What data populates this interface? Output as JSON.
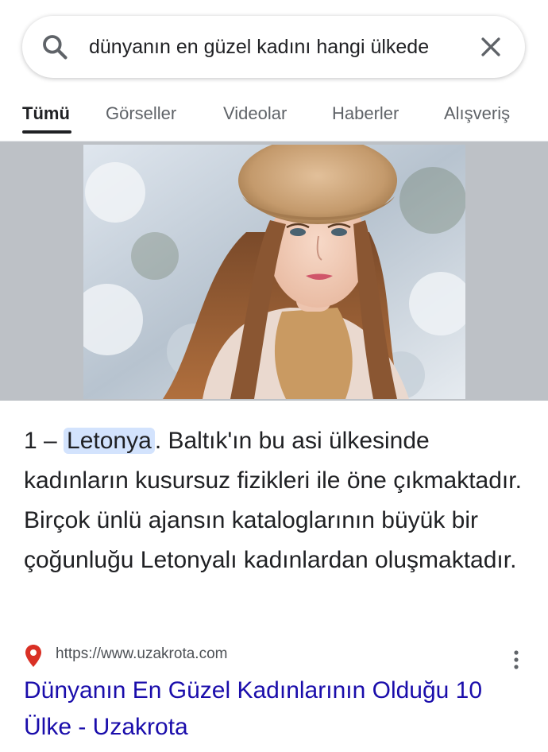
{
  "search": {
    "query": "dünyanın en güzel kadını hangi ülkede",
    "search_icon": "search-icon",
    "clear_icon": "close-icon"
  },
  "tabs": [
    {
      "label": "Tümü",
      "active": true
    },
    {
      "label": "Görseller",
      "active": false
    },
    {
      "label": "Videolar",
      "active": false
    },
    {
      "label": "Haberler",
      "active": false
    },
    {
      "label": "Alışveriş",
      "active": false
    }
  ],
  "featured_snippet": {
    "image_subject": "portrait of a woman wearing a fur hat in a snowy setting",
    "prefix": "1 – ",
    "highlight": "Letonya",
    "text": ". Baltık'ın bu asi ülkesinde kadınların kusursuz fizikleri ile öne çıkmaktadır. Birçok ünlü ajansın kataloglarının büyük bir çoğunluğu Letonyalı kadınlardan oluşmaktadır."
  },
  "source": {
    "url": "https://www.uzakrota.com",
    "title": "Dünyanın En Güzel Kadınlarının Olduğu 10 Ülke - Uzakrota",
    "favicon": "location-pin-icon",
    "menu_icon": "more-vert-icon"
  },
  "colors": {
    "link": "#1a0dab",
    "highlight": "#d3e3fd",
    "image_band": "#bdc1c6",
    "pin": "#d93025"
  }
}
